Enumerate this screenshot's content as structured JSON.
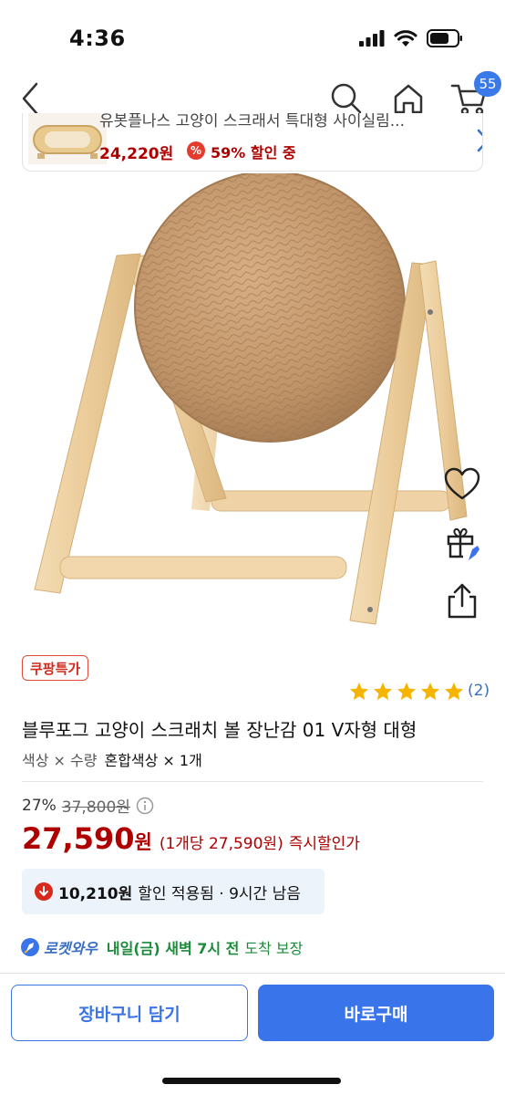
{
  "status_bar": {
    "time": "4:36"
  },
  "header": {
    "cart_count": "55"
  },
  "related": {
    "title": "유봇플나스 고양이 스크래서 특대형 사이실림...",
    "price": "24,220원",
    "discount_icon": "%",
    "discount": "59% 할인 중"
  },
  "product": {
    "badge": "쿠팡특가",
    "rating_stars": 5,
    "review_count": "(2)",
    "title": "블루포그 고양이 스크래치 볼 장난감 01 V자형 대형",
    "option_label": "색상 × 수량",
    "option_value": "혼합색상 × 1개"
  },
  "price": {
    "discount_rate": "27%",
    "original": "37,800원",
    "sale": "27,590",
    "sale_unit": "원",
    "per_unit": "(1개당 27,590원)",
    "sale_label": "즉시할인가"
  },
  "coupon": {
    "amount": "10,210원",
    "text": "할인 적용됨 · 9시간 남음"
  },
  "delivery": {
    "brand": "로켓와우",
    "date": "내일(금) 새벽 7시 전",
    "suffix": "도착 보장"
  },
  "actions": {
    "add_to_cart": "장바구니 담기",
    "buy_now": "바로구매"
  },
  "colors": {
    "accent_blue": "#3a74ea",
    "price_red": "#ae0000",
    "star_gold": "#f5b400"
  },
  "icons": [
    "back-icon",
    "search-icon",
    "home-icon",
    "cart-icon",
    "heart-icon",
    "gift-icon",
    "share-icon",
    "info-icon",
    "chevron-right-icon",
    "rocket-icon"
  ]
}
